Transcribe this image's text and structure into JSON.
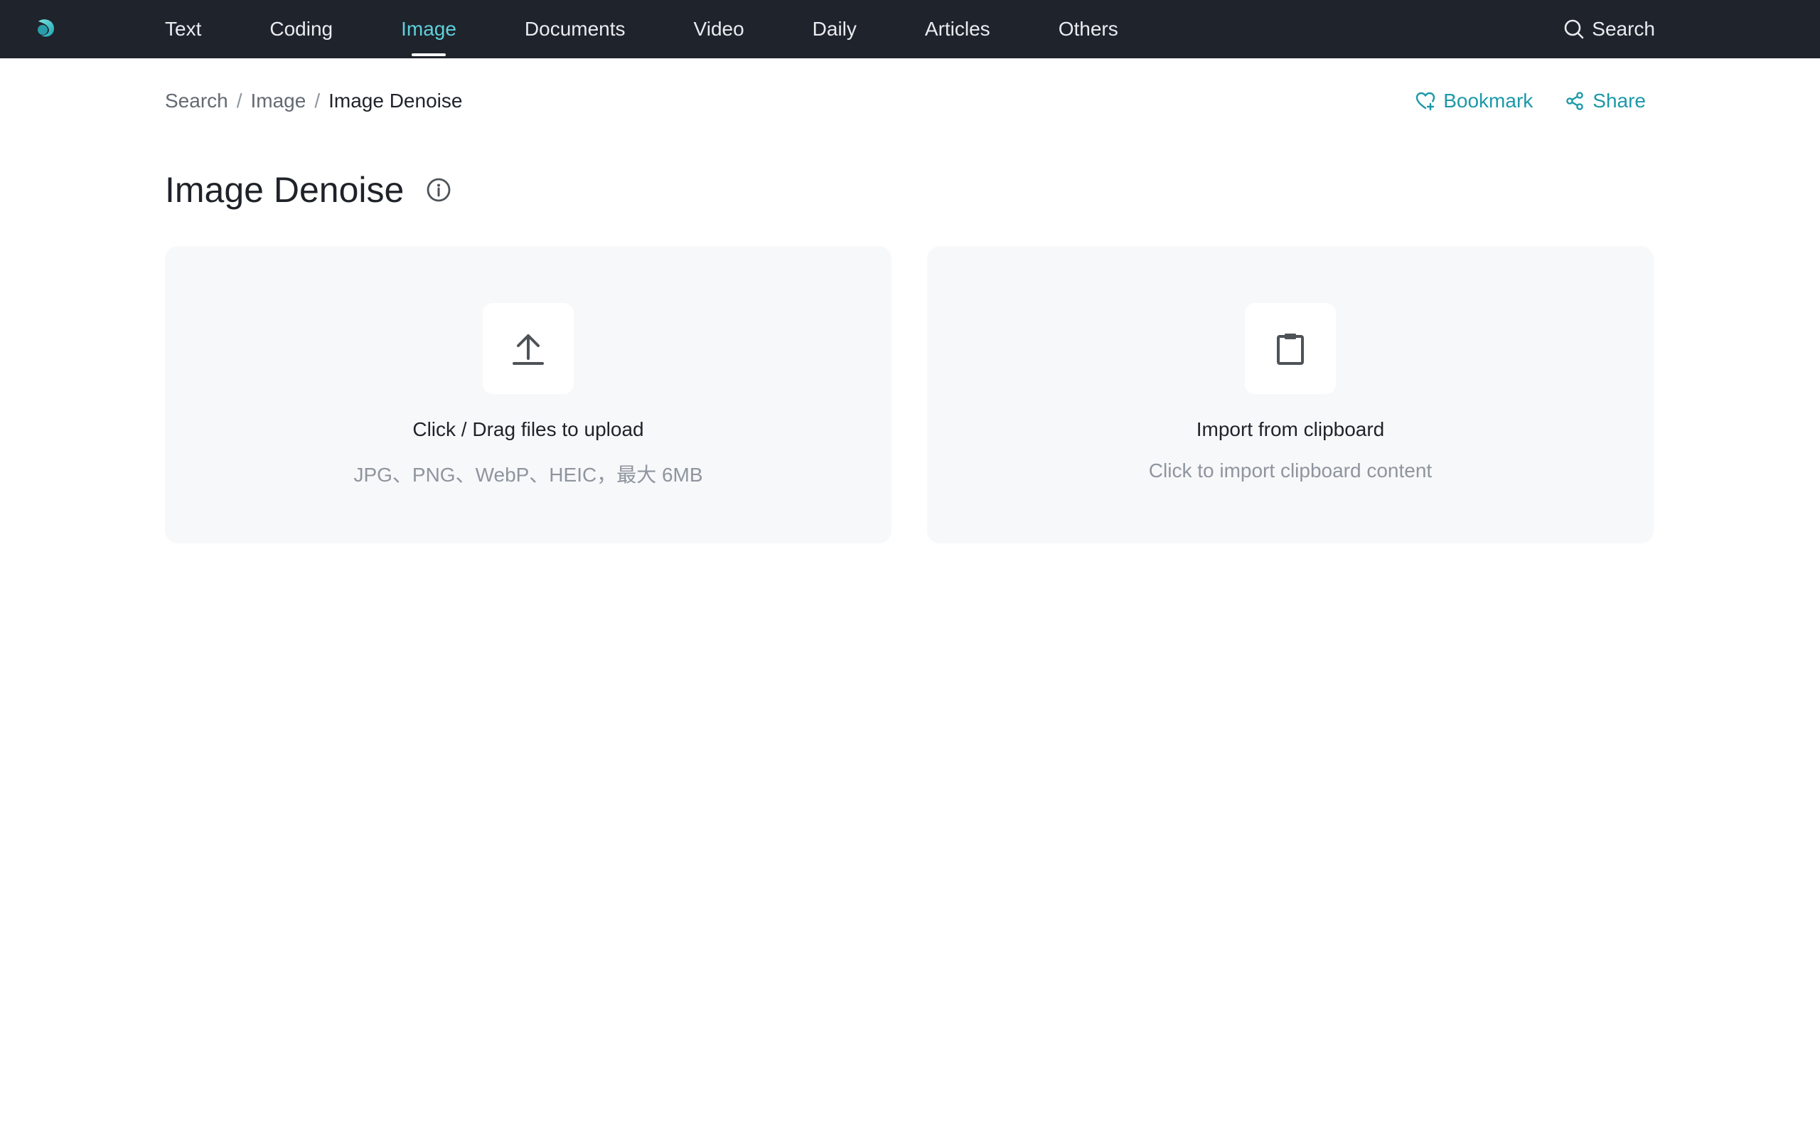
{
  "nav": {
    "items": [
      {
        "label": "Text",
        "active": false
      },
      {
        "label": "Coding",
        "active": false
      },
      {
        "label": "Image",
        "active": true
      },
      {
        "label": "Documents",
        "active": false
      },
      {
        "label": "Video",
        "active": false
      },
      {
        "label": "Daily",
        "active": false
      },
      {
        "label": "Articles",
        "active": false
      },
      {
        "label": "Others",
        "active": false
      }
    ],
    "search_label": "Search",
    "search_icon": "search-icon",
    "logo_icon": "app-logo"
  },
  "breadcrumb": {
    "items": [
      "Search",
      "Image"
    ],
    "current": "Image Denoise",
    "separator": "/"
  },
  "actions": {
    "bookmark_label": "Bookmark",
    "bookmark_icon": "heart-plus-icon",
    "share_label": "Share",
    "share_icon": "share-icon"
  },
  "page": {
    "title": "Image Denoise",
    "info_icon": "info-icon"
  },
  "upload_card": {
    "icon": "upload-icon",
    "title": "Click / Drag files to upload",
    "subtitle": "JPG、PNG、WebP、HEIC，最大 6MB"
  },
  "clipboard_card": {
    "icon": "clipboard-icon",
    "title": "Import from clipboard",
    "subtitle": "Click to import clipboard content"
  },
  "colors": {
    "topbar_bg": "#1f232c",
    "nav_active": "#5fd0da",
    "accent": "#1d99a8",
    "card_bg": "#f7f8fa"
  }
}
